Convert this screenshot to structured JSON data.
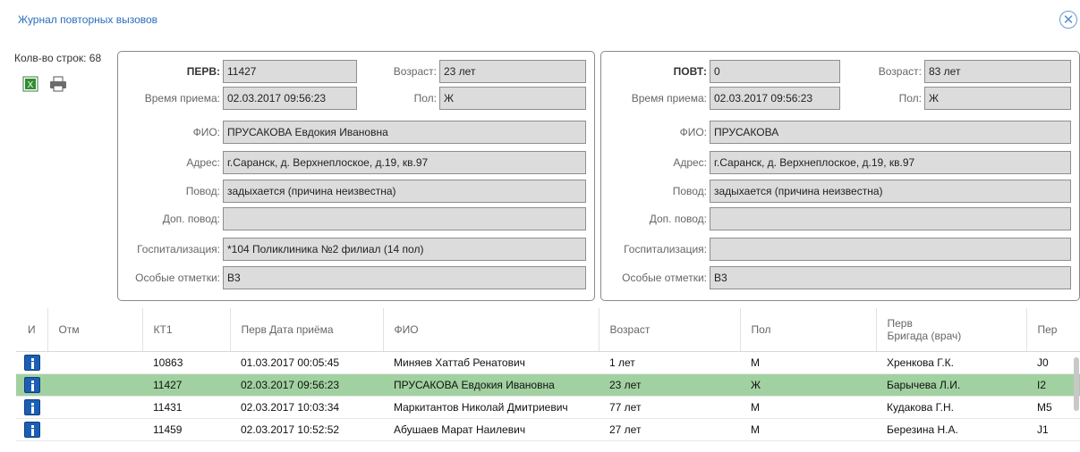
{
  "dialog": {
    "title": "Журнал повторных вызовов",
    "close_icon": "close-circle-icon"
  },
  "toolbar": {
    "row_count_label": "Колв-во строк: 68",
    "export_excel_icon": "excel-export-icon",
    "print_icon": "printer-icon"
  },
  "primary": {
    "call_label": "ПЕРВ:",
    "call_value": "11427",
    "age_label": "Возраст:",
    "age_value": "23 лет",
    "time_label": "Время приема:",
    "time_value": "02.03.2017 09:56:23",
    "sex_label": "Пол:",
    "sex_value": "Ж",
    "name_label": "ФИО:",
    "name_value": "ПРУСАКОВА Евдокия Ивановна",
    "address_label": "Адрес:",
    "address_value": "г.Саранск, д. Верхнеплоское, д.19, кв.97",
    "reason_label": "Повод:",
    "reason_value": "задыхается (причина неизвестна)",
    "extra_reason_label": "Доп. повод:",
    "extra_reason_value": "",
    "hosp_label": "Госпитализация:",
    "hosp_value": "*104 Поликлиника №2 филиал (14 пол)",
    "notes_label": "Особые отметки:",
    "notes_value": "В3"
  },
  "repeat": {
    "call_label": "ПОВТ:",
    "call_value": "0",
    "age_label": "Возраст:",
    "age_value": "83 лет",
    "time_label": "Время приема:",
    "time_value": "02.03.2017 09:56:23",
    "sex_label": "Пол:",
    "sex_value": "Ж",
    "name_label": "ФИО:",
    "name_value": "ПРУСАКОВА",
    "address_label": "Адрес:",
    "address_value": "г.Саранск, д. Верхнеплоское, д.19, кв.97",
    "reason_label": "Повод:",
    "reason_value": "задыхается (причина неизвестна)",
    "extra_reason_label": "Доп. повод:",
    "extra_reason_value": "",
    "hosp_label": "Госпитализация:",
    "hosp_value": "",
    "notes_label": "Особые отметки:",
    "notes_value": "В3"
  },
  "grid": {
    "columns": [
      "И",
      "Отм",
      "КТ1",
      "Перв Дата приёма",
      "ФИО",
      "Возраст",
      "Пол",
      "Перв\nБригада (врач)",
      "Пер"
    ],
    "selected_row": 1,
    "rows": [
      {
        "otm": "",
        "kt1": "10863",
        "date": "01.03.2017 00:05:45",
        "fio": "Миняев Хаттаб Ренатович",
        "age": "1 лет",
        "sex": "М",
        "brigade": "Хренкова Г.К.",
        "extra": "J0"
      },
      {
        "otm": "",
        "kt1": "11427",
        "date": "02.03.2017 09:56:23",
        "fio": "ПРУСАКОВА Евдокия Ивановна",
        "age": "23 лет",
        "sex": "Ж",
        "brigade": "Барычева Л.И.",
        "extra": "I2"
      },
      {
        "otm": "",
        "kt1": "11431",
        "date": "02.03.2017 10:03:34",
        "fio": "Маркитантов Николай Дмитриевич",
        "age": "77 лет",
        "sex": "М",
        "brigade": "Кудакова Г.Н.",
        "extra": "M5"
      },
      {
        "otm": "",
        "kt1": "11459",
        "date": "02.03.2017 10:52:52",
        "fio": "Абушаев Марат Наилевич",
        "age": "27 лет",
        "sex": "М",
        "brigade": "Березина Н.А.",
        "extra": "J1"
      }
    ]
  }
}
